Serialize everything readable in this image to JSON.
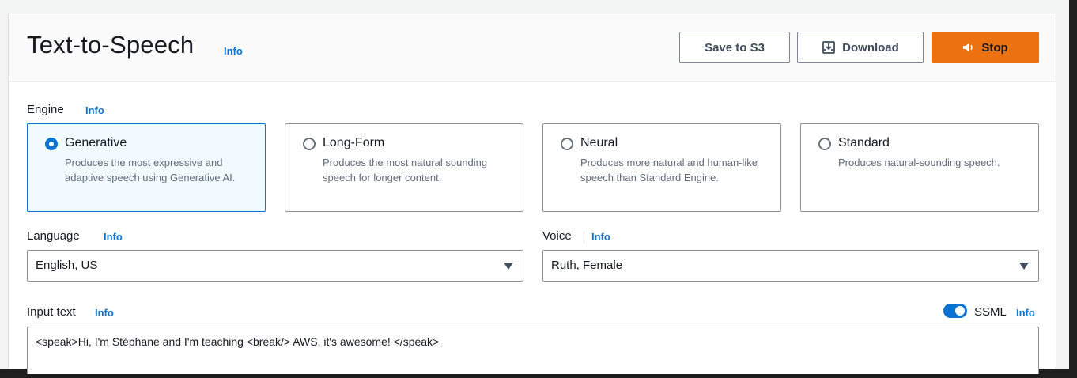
{
  "header": {
    "title": "Text-to-Speech",
    "info": "Info",
    "save_label": "Save to S3",
    "download_label": "Download",
    "stop_label": "Stop"
  },
  "engine": {
    "label": "Engine",
    "info": "Info",
    "options": [
      {
        "name": "Generative",
        "desc": "Produces the most expressive and adaptive speech using Generative AI.",
        "selected": true
      },
      {
        "name": "Long-Form",
        "desc": "Produces the most natural sounding speech for longer content.",
        "selected": false
      },
      {
        "name": "Neural",
        "desc": "Produces more natural and human-like speech than Standard Engine.",
        "selected": false
      },
      {
        "name": "Standard",
        "desc": "Produces natural-sounding speech.",
        "selected": false
      }
    ]
  },
  "language": {
    "label": "Language",
    "info": "Info",
    "value": "English, US"
  },
  "voice": {
    "label": "Voice",
    "info": "Info",
    "value": "Ruth, Female"
  },
  "input": {
    "label": "Input text",
    "info": "Info",
    "ssml_label": "SSML",
    "ssml_info": "Info",
    "ssml_enabled": true,
    "value": "<speak>Hi, I'm Stéphane and I'm teaching <break/> AWS, it's awesome! </speak>"
  },
  "colors": {
    "accent": "#0972d3",
    "primary_button": "#ec7211",
    "selected_bg": "#f1faff"
  }
}
